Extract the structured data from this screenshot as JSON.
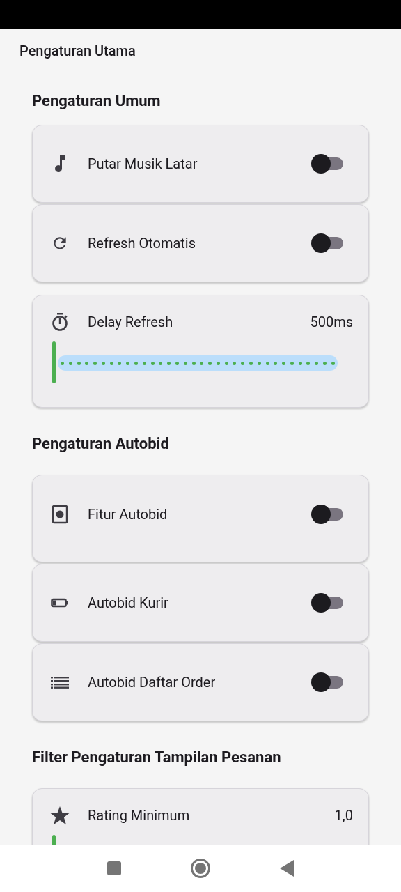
{
  "title": "Pengaturan Utama",
  "sections": [
    {
      "heading": "Pengaturan Umum",
      "items": [
        {
          "kind": "toggle",
          "label": "Putar Musik Latar",
          "on": false
        },
        {
          "kind": "toggle",
          "label": "Refresh Otomatis",
          "on": false
        },
        {
          "kind": "slider",
          "label": "Delay Refresh",
          "reading": "500ms",
          "level": 0
        }
      ]
    },
    {
      "heading": "Pengaturan Autobid",
      "items": [
        {
          "kind": "toggle",
          "label": "Fitur Autobid",
          "on": false
        },
        {
          "kind": "toggle",
          "label": "Autobid Kurir",
          "on": false
        },
        {
          "kind": "toggle",
          "label": "Autobid Daftar Order",
          "on": false
        }
      ]
    },
    {
      "heading": "Filter Pengaturan Tampilan Pesanan",
      "items": [
        {
          "kind": "slider",
          "label": "Rating Minimum",
          "reading": "1,0",
          "level": 0
        }
      ]
    }
  ]
}
